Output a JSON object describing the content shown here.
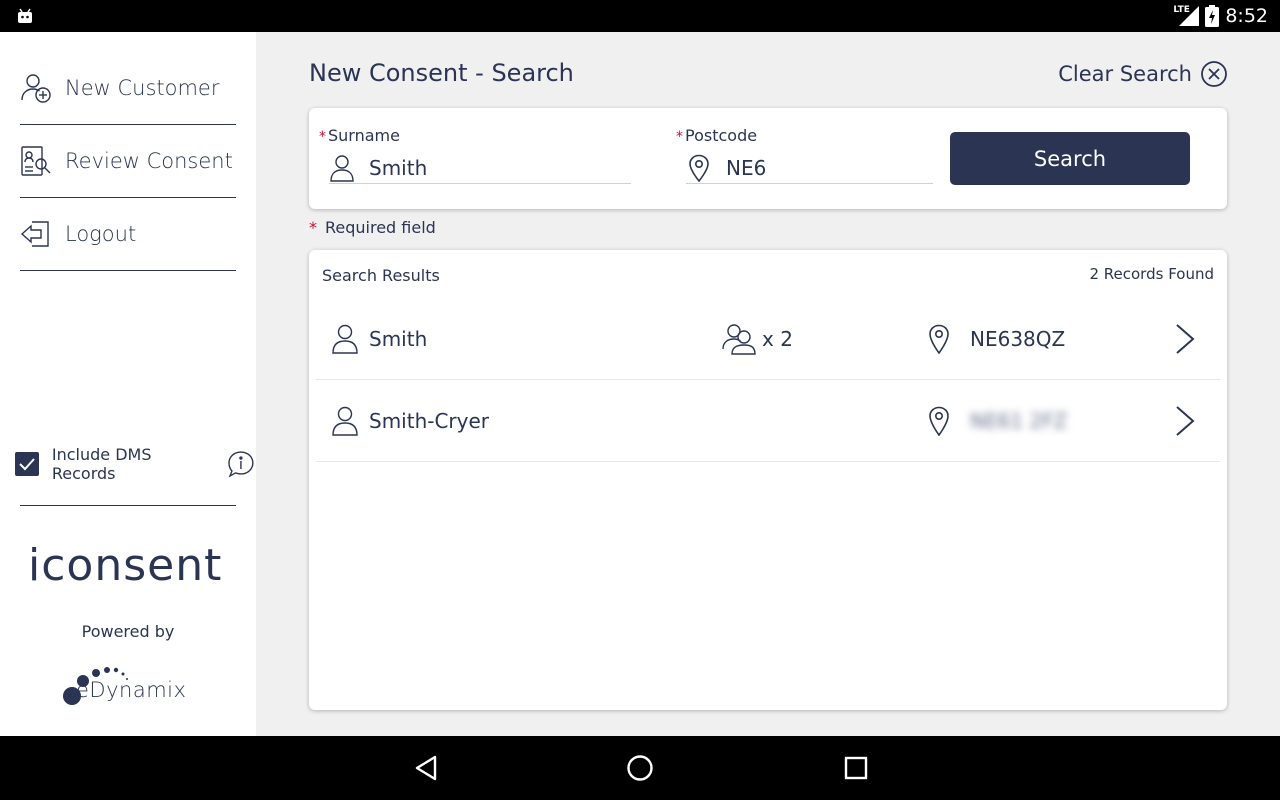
{
  "status_bar": {
    "network": "LTE",
    "time": "8:52"
  },
  "sidebar": {
    "items": [
      {
        "label": "New Customer",
        "icon": "add-user-icon"
      },
      {
        "label": "Review Consent",
        "icon": "review-document-icon"
      },
      {
        "label": "Logout",
        "icon": "logout-icon"
      }
    ],
    "dms_label": "Include DMS Records",
    "dms_checked": true,
    "logo_text": "iconsent",
    "powered_by": "Powered by",
    "partner_logo_text": "eDynamix"
  },
  "main": {
    "title": "New Consent - Search",
    "clear_search": "Clear Search",
    "surname": {
      "label": "Surname",
      "value": "Smith",
      "required": "*"
    },
    "postcode": {
      "label": "Postcode",
      "value": "NE6",
      "required": "*"
    },
    "search_button": "Search",
    "required_note": {
      "mark": "*",
      "text": "Required field"
    }
  },
  "results": {
    "title": "Search Results",
    "count_text": "2 Records Found",
    "rows": [
      {
        "name": "Smith",
        "group_count": "x 2",
        "postcode": "NE638QZ",
        "postcode_blurred": false
      },
      {
        "name": "Smith-Cryer",
        "group_count": "",
        "postcode": "NE61 2FZ",
        "postcode_blurred": true
      }
    ]
  },
  "colors": {
    "primary": "#2b3452",
    "required": "#c8102e",
    "background": "#f0f0f0"
  }
}
